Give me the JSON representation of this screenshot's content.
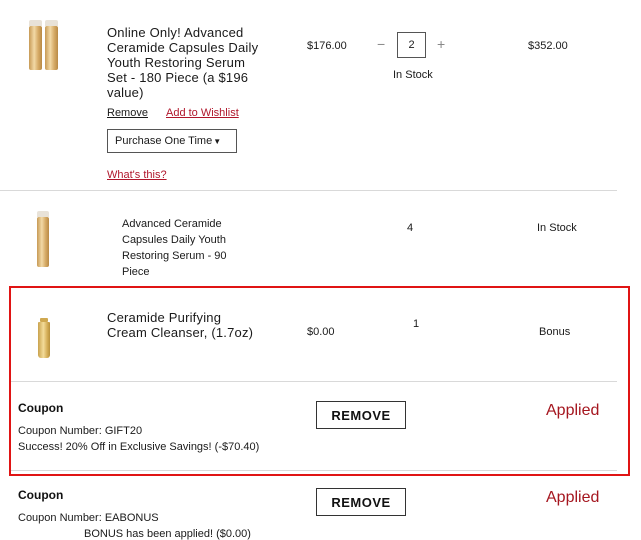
{
  "item1": {
    "title_lines": [
      "Online Only! Advanced",
      "Ceramide Capsules Daily",
      "Youth Restoring Serum",
      "Set - 180 Piece (a $196",
      "value)"
    ],
    "price": "$176.00",
    "quantity": "2",
    "qty_minus": "−",
    "qty_plus": "+",
    "stock": "In Stock",
    "total": "$352.00",
    "remove_label": "Remove",
    "wishlist_label": "Add to Wishlist",
    "purchase_option": "Purchase One Time",
    "whats_this": "What's this?"
  },
  "item2": {
    "title_lines": [
      "Advanced Ceramide",
      "Capsules Daily Youth",
      "Restoring Serum - 90",
      "Piece"
    ],
    "quantity": "4",
    "stock": "In Stock"
  },
  "item3": {
    "title_lines": [
      "Ceramide Purifying",
      "Cream Cleanser, (1.7oz)"
    ],
    "price": "$0.00",
    "quantity": "1",
    "status": "Bonus"
  },
  "coupon1": {
    "heading": "Coupon",
    "number": "Coupon Number: GIFT20",
    "message": "Success! 20% Off in Exclusive Savings! (-$70.40)",
    "remove_label": "REMOVE",
    "status": "Applied"
  },
  "coupon2": {
    "heading": "Coupon",
    "number": "Coupon Number: EABONUS",
    "message": "BONUS has been applied! ($0.00)",
    "remove_label": "REMOVE",
    "status": "Applied"
  },
  "colors": {
    "highlight_border": "#e01414",
    "link_red": "#b0162b",
    "applied_red": "#a5161f"
  }
}
